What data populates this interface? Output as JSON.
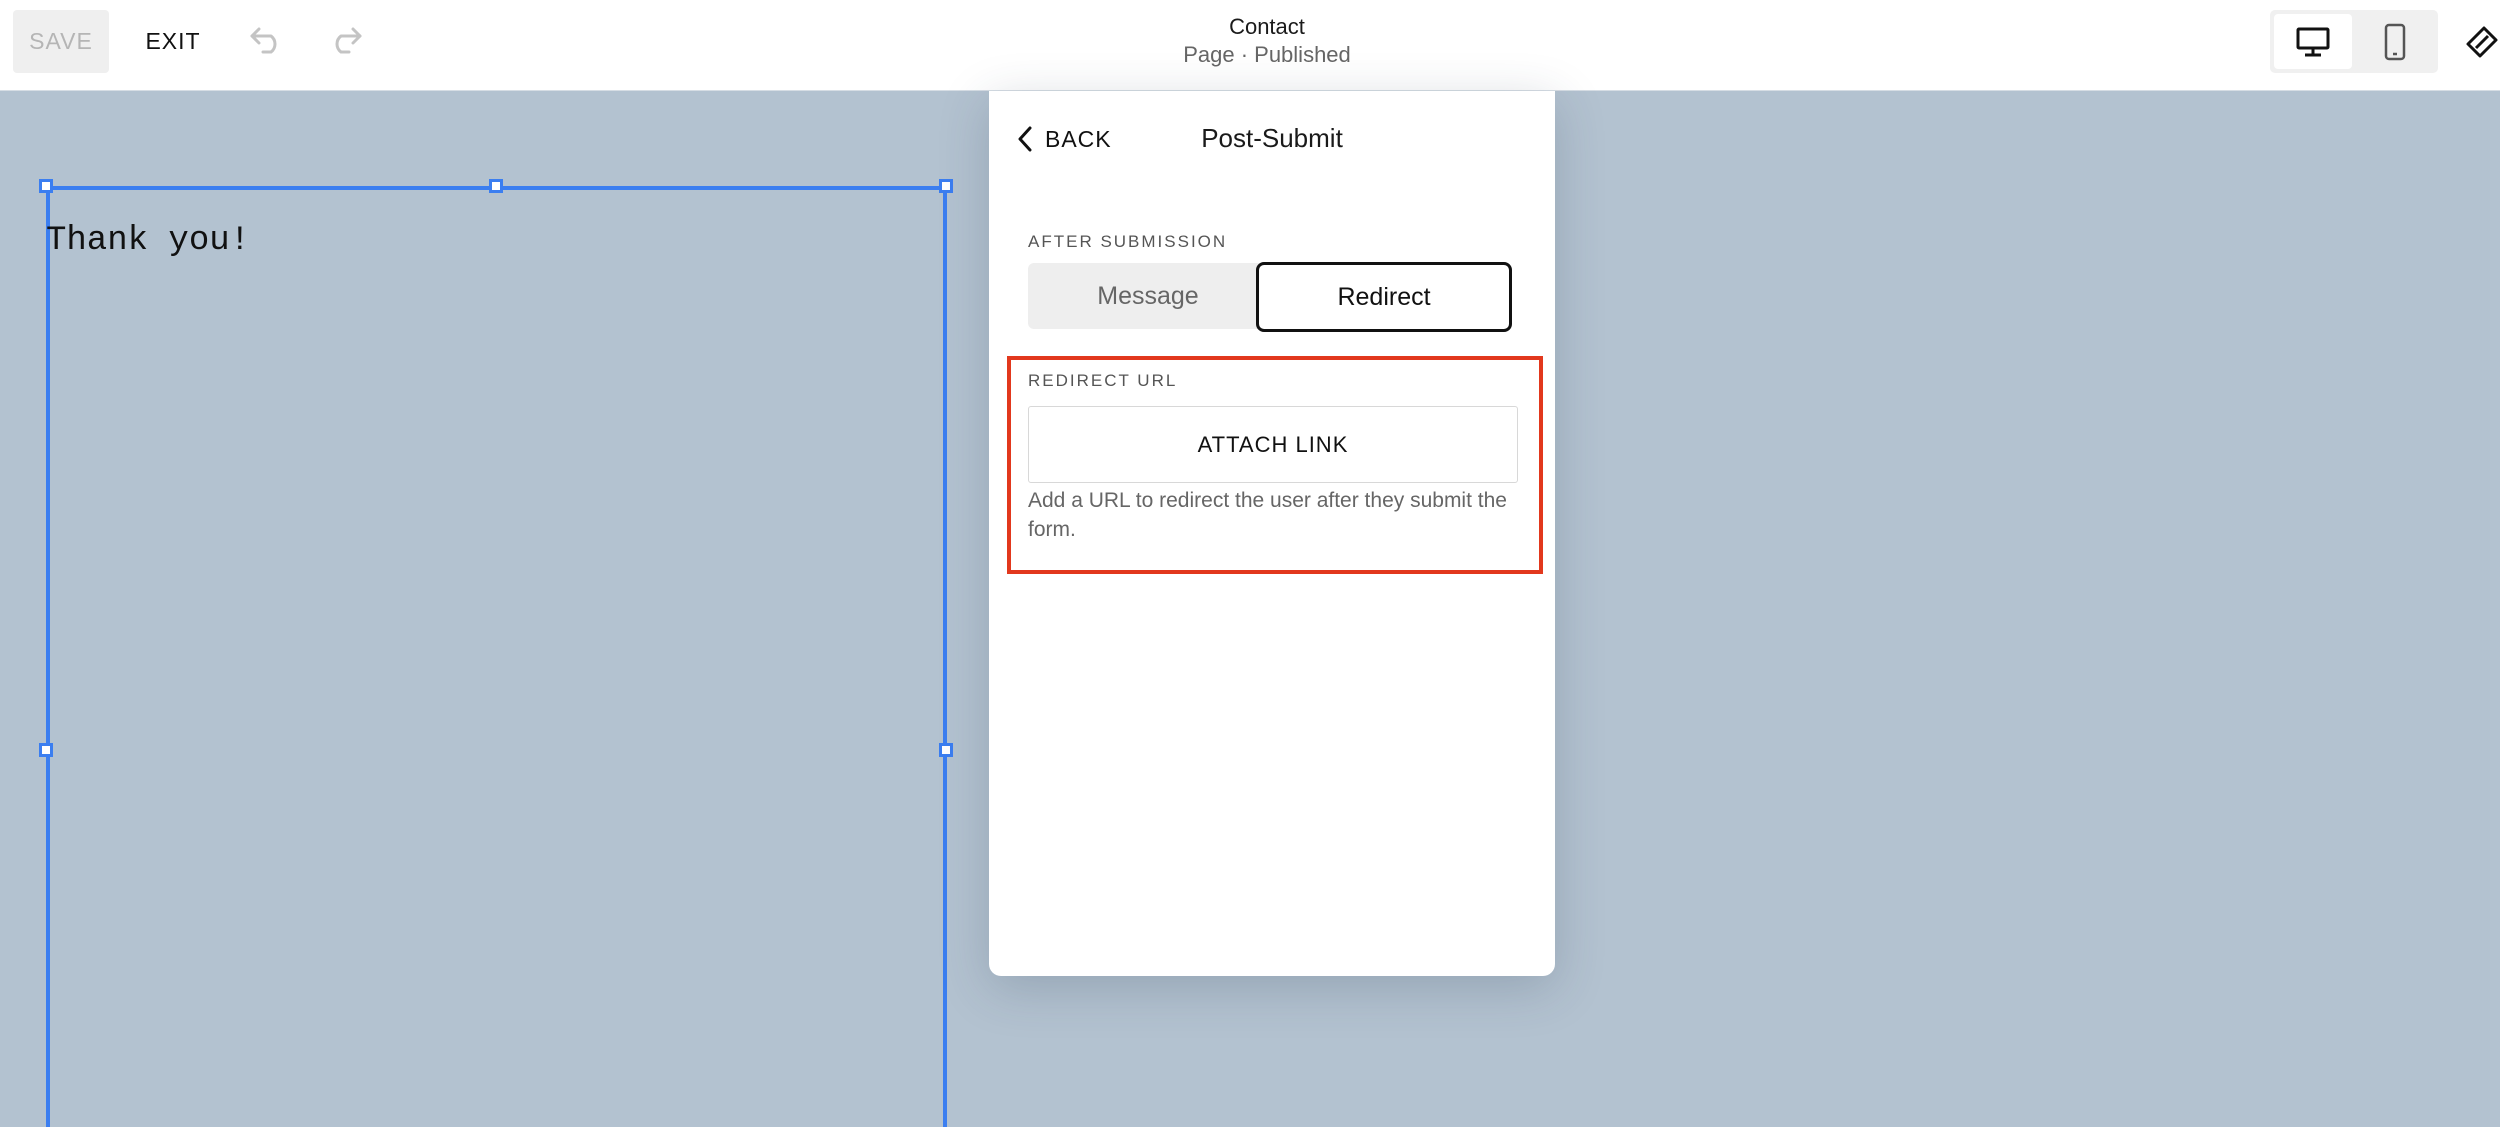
{
  "toolbar": {
    "save_label": "SAVE",
    "exit_label": "EXIT",
    "undo_icon": "undo-icon",
    "redo_icon": "redo-icon"
  },
  "page_info": {
    "title": "Contact",
    "subtitle": "Page · Published"
  },
  "device_toggle": {
    "selected": "desktop",
    "options": [
      "desktop-icon",
      "mobile-icon"
    ]
  },
  "canvas": {
    "text": "Thank you!"
  },
  "panel": {
    "back_label": "BACK",
    "title": "Post-Submit",
    "after_submission_label": "AFTER SUBMISSION",
    "options": [
      "Message",
      "Redirect"
    ],
    "selected_option": "Redirect",
    "redirect_url_label": "REDIRECT URL",
    "attach_link_label": "ATTACH LINK",
    "helper_text": "Add a URL to redirect the user after they submit the form."
  },
  "colors": {
    "canvas_bg": "#b3c2d0",
    "selection": "#3b7ef0",
    "highlight": "#e2381d"
  }
}
